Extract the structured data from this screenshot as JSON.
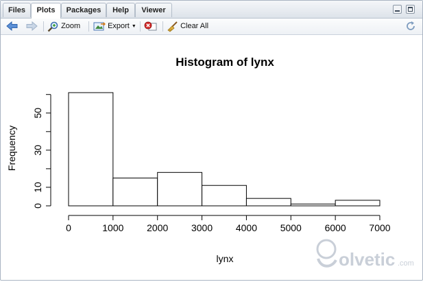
{
  "tabs": [
    {
      "label": "Files"
    },
    {
      "label": "Plots",
      "active": true
    },
    {
      "label": "Packages"
    },
    {
      "label": "Help"
    },
    {
      "label": "Viewer"
    }
  ],
  "toolbar": {
    "back_icon": "arrow-left-icon",
    "forward_icon": "arrow-right-icon",
    "zoom_label": "Zoom",
    "export_label": "Export",
    "remove_icon": "remove-plot-icon",
    "clear_all_label": "Clear All",
    "refresh_icon": "refresh-icon"
  },
  "chart_data": {
    "type": "bar",
    "title": "Histogram of lynx",
    "xlabel": "lynx",
    "ylabel": "Frequency",
    "bins": [
      {
        "from": 0,
        "to": 1000,
        "count": 61
      },
      {
        "from": 1000,
        "to": 2000,
        "count": 15
      },
      {
        "from": 2000,
        "to": 3000,
        "count": 18
      },
      {
        "from": 3000,
        "to": 4000,
        "count": 11
      },
      {
        "from": 4000,
        "to": 5000,
        "count": 4
      },
      {
        "from": 5000,
        "to": 6000,
        "count": 1
      },
      {
        "from": 6000,
        "to": 7000,
        "count": 3
      }
    ],
    "xticks": [
      0,
      1000,
      2000,
      3000,
      4000,
      5000,
      6000,
      7000
    ],
    "yticks": [
      0,
      10,
      30,
      50
    ],
    "xlim": [
      0,
      7000
    ],
    "ylim": [
      0,
      61
    ],
    "grid": false
  },
  "watermark": {
    "text": "olvetic",
    "suffix": ".com",
    "color": "#c9cfd8"
  }
}
